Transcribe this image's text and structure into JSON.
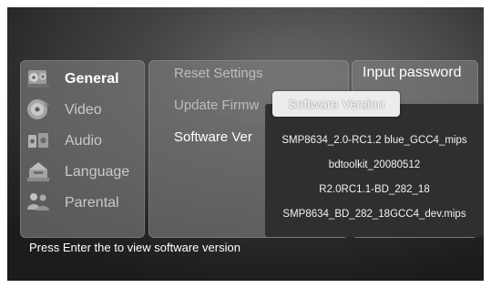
{
  "menu": {
    "items": [
      {
        "label": "General",
        "icon": "film-reel-icon",
        "selected": true
      },
      {
        "label": "Video",
        "icon": "video-disc-icon",
        "selected": false
      },
      {
        "label": "Audio",
        "icon": "audio-speaker-icon",
        "selected": false
      },
      {
        "label": "Language",
        "icon": "globe-language-icon",
        "selected": false
      },
      {
        "label": "Parental",
        "icon": "parental-users-icon",
        "selected": false
      }
    ]
  },
  "submenu": {
    "items": [
      {
        "label": "Reset Settings"
      },
      {
        "label": "Update Firmw"
      },
      {
        "label": "Software Ver"
      }
    ]
  },
  "right_panel": {
    "title": "Input password"
  },
  "popup": {
    "title": "Software Version",
    "lines": [
      "SMP8634_2.0-RC1.2 blue_GCC4_mips",
      "bdtoolkit_20080512",
      "R2.0RC1.1-BD_282_18",
      "SMP8634_BD_282_18GCC4_dev.mips"
    ]
  },
  "status": {
    "text": "Press Enter the to view software version"
  },
  "colors": {
    "panel": "#808080",
    "popup_bg": "#2f2f2f",
    "header_bg": "#ececec",
    "text": "#ffffff"
  }
}
